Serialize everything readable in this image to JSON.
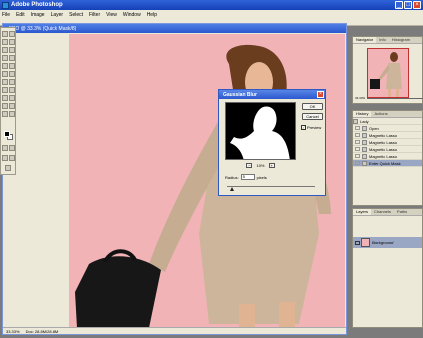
{
  "window": {
    "title": "Adobe Photoshop"
  },
  "menu": [
    "File",
    "Edit",
    "Image",
    "Layer",
    "Select",
    "Filter",
    "View",
    "Window",
    "Help"
  ],
  "document": {
    "title": "FPO @ 33.3% (Quick Mask/8)",
    "status_zoom": "33.33%",
    "status_doc": "Doc: 28.8M/28.8M"
  },
  "dialog": {
    "title": "Gaussian Blur",
    "ok_label": "OK",
    "cancel_label": "Cancel",
    "preview_label": "Preview",
    "preview_checked": true,
    "zoom_out": "−",
    "zoom_in": "+",
    "zoom_value": "10%",
    "radius_label": "Radius:",
    "radius_value": "5",
    "radius_unit": "pixels",
    "radius_slider_fraction": 0.06
  },
  "navigator": {
    "tabs": [
      "Navigator",
      "Info",
      "Histogram"
    ],
    "zoom_text": "33.33%"
  },
  "history": {
    "tabs": [
      "History",
      "Actions"
    ],
    "document_name": "Lady",
    "items": [
      {
        "label": "Open",
        "selected": false
      },
      {
        "label": "Magnetic Lasso",
        "selected": false
      },
      {
        "label": "Magnetic Lasso",
        "selected": false
      },
      {
        "label": "Magnetic Lasso",
        "selected": false
      },
      {
        "label": "Magnetic Lasso",
        "selected": false
      },
      {
        "label": "Enter Quick Mask",
        "selected": true
      }
    ]
  },
  "layers": {
    "tabs": [
      "Layers",
      "Channels",
      "Paths"
    ],
    "items": [
      {
        "label": "Background"
      }
    ]
  },
  "colors": {
    "canvas_pink": "#f2b3b7",
    "titlebar_blue": "#2b58cf",
    "panel_bg": "#ece9d8"
  }
}
